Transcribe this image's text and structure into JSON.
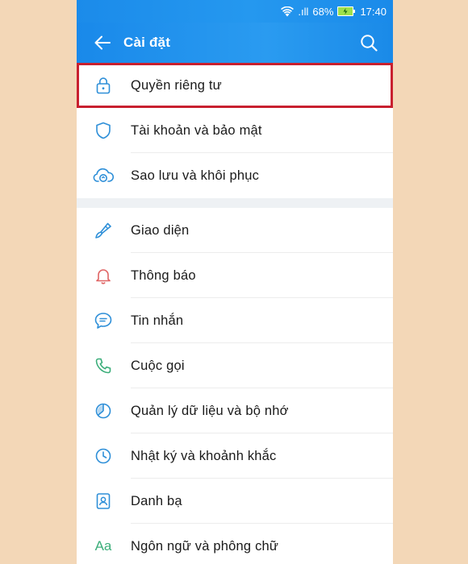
{
  "status_bar": {
    "battery_percent": "68%",
    "time": "17:40",
    "signal_label": ".ıll"
  },
  "header": {
    "title": "Cài đặt"
  },
  "sections": [
    {
      "items": [
        {
          "label": "Quyền riêng tư",
          "icon": "lock-icon",
          "highlighted": true
        },
        {
          "label": "Tài khoản và bảo mật",
          "icon": "shield-icon"
        },
        {
          "label": "Sao lưu và khôi phục",
          "icon": "cloud-sync-icon"
        }
      ]
    },
    {
      "items": [
        {
          "label": "Giao diện",
          "icon": "paintbrush-icon"
        },
        {
          "label": "Thông báo",
          "icon": "bell-icon"
        },
        {
          "label": "Tin nhắn",
          "icon": "chat-bubble-icon"
        },
        {
          "label": "Cuộc gọi",
          "icon": "phone-icon"
        },
        {
          "label": "Quản lý dữ liệu và bộ nhớ",
          "icon": "pie-chart-icon"
        },
        {
          "label": "Nhật ký và khoảnh khắc",
          "icon": "clock-icon"
        },
        {
          "label": "Danh bạ",
          "icon": "contacts-icon"
        },
        {
          "label": "Ngôn ngữ và phông chữ",
          "icon": "font-icon",
          "glyph": "Aa"
        }
      ]
    }
  ],
  "colors": {
    "header_blue": "#1b8bea",
    "highlight_red": "#c8202f",
    "icon_blue": "#2e8fd8",
    "icon_green": "#3cae7a",
    "icon_red": "#e06666",
    "background": "#f3d7b7"
  }
}
